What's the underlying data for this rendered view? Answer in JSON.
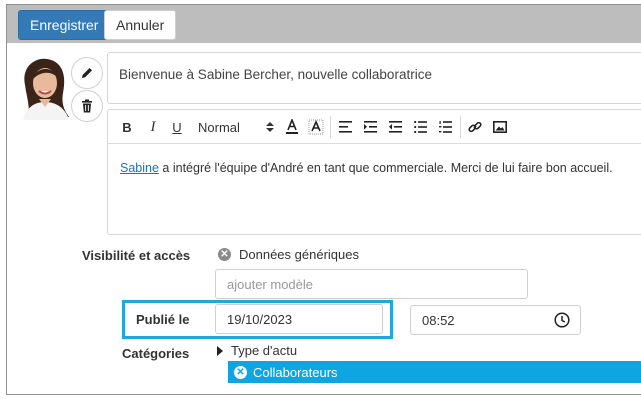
{
  "toolbar": {
    "save_label": "Enregistrer",
    "cancel_label": "Annuler"
  },
  "news": {
    "title": "Bienvenue à Sabine Bercher, nouvelle collaboratrice",
    "body_link": "Sabine",
    "body_rest": " a intégré l'équipe d'André en tant que commerciale. Merci de lui faire bon accueil."
  },
  "editor": {
    "tools": [
      "bold-icon",
      "italic-icon",
      "underline-icon",
      "font-color-icon",
      "highlight-icon",
      "align-left-icon",
      "indent-icon",
      "outdent-icon",
      "bullet-list-icon",
      "numbered-list-icon",
      "link-icon",
      "image-icon"
    ],
    "format_value": "Normal"
  },
  "form": {
    "visibility_label": "Visibilité et accès",
    "visibility_value": "Données génériques",
    "model_placeholder": "ajouter modèle",
    "published_label": "Publié le",
    "published_date": "19/10/2023",
    "published_time": "08:52",
    "categories_label": "Catégories",
    "category_tree_item": "Type d'actu",
    "selected_category": "Collaborateurs"
  },
  "colors": {
    "primary": "#337ab7",
    "highlight": "#1fa7de",
    "chip": "#0ea5e0"
  }
}
